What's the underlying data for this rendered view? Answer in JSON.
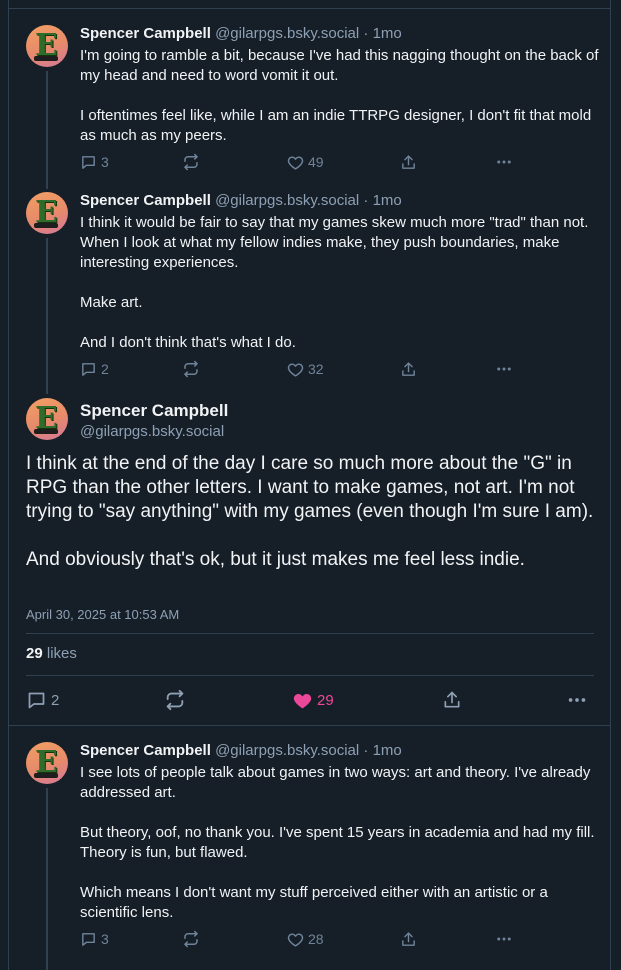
{
  "posts": [
    {
      "author": "Spencer Campbell",
      "handle": "@gilarpgs.bsky.social",
      "sep": "·",
      "time": "1mo",
      "paragraphs": [
        "I'm going to ramble a bit, because I've had this nagging thought on the back of my head and need to word vomit it out.",
        "I oftentimes feel like, while I am an indie TTRPG designer, I don't fit that mold as much as my peers."
      ],
      "replies": "3",
      "likes": "49"
    },
    {
      "author": "Spencer Campbell",
      "handle": "@gilarpgs.bsky.social",
      "sep": "·",
      "time": "1mo",
      "paragraphs": [
        "I think it would be fair to say that my games skew much more \"trad\" than not. When I look at what my fellow indies make, they push boundaries, make interesting experiences.",
        "Make art.",
        "And I don't think that's what I do."
      ],
      "replies": "2",
      "likes": "32"
    }
  ],
  "focus": {
    "author": "Spencer Campbell",
    "handle": "@gilarpgs.bsky.social",
    "paragraphs": [
      "I think at the end of the day I care so much more about the \"G\" in RPG than the other letters. I want to make games, not art. I'm not trying to \"say anything\" with my games (even though I'm sure I am).",
      "And obviously that's ok, but it just makes me feel less indie."
    ],
    "date": "April 30, 2025 at 10:53 AM",
    "like_count": "29",
    "like_word": "likes",
    "replies": "2",
    "likes": "29"
  },
  "reply": {
    "author": "Spencer Campbell",
    "handle": "@gilarpgs.bsky.social",
    "sep": "·",
    "time": "1mo",
    "paragraphs": [
      "I see lots of people talk about games in two ways: art and theory. I've already addressed art.",
      "But theory, oof, no thank you. I've spent 15 years in academia and had my fill. Theory is fun, but flawed.",
      "Which means I don't want my stuff perceived either with an artistic or a scientific lens."
    ],
    "replies": "3",
    "likes": "28"
  },
  "colors": {
    "background": "#161e27",
    "border": "#2e4052",
    "muted": "#8da0b4",
    "like_active": "#ec4899"
  },
  "icons": [
    "reply-icon",
    "repost-icon",
    "heart-icon",
    "share-icon",
    "more-icon"
  ]
}
